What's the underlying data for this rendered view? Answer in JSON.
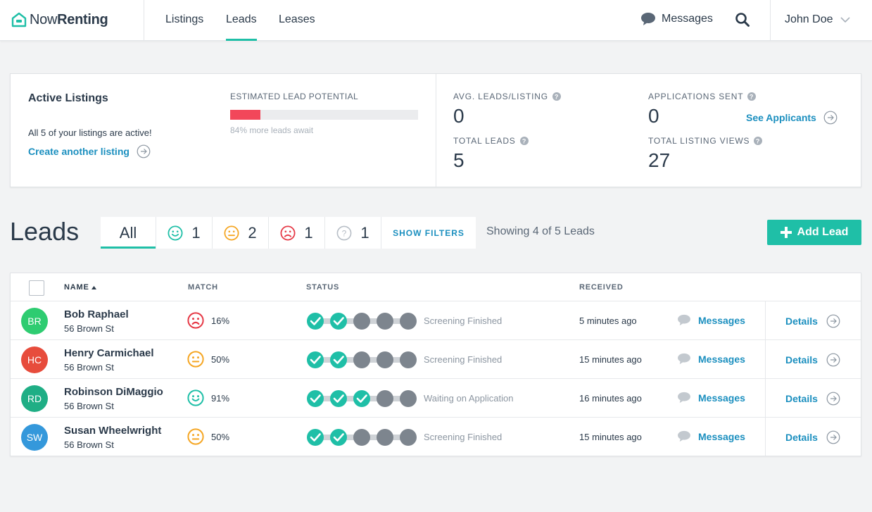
{
  "brand": {
    "name_regular": "Now",
    "name_bold": "Renting",
    "color": "#1fbfa7"
  },
  "nav": {
    "items": [
      {
        "label": "Listings"
      },
      {
        "label": "Leads"
      },
      {
        "label": "Leases"
      }
    ],
    "active": "Leads",
    "messages_label": "Messages",
    "user_name": "John Doe"
  },
  "summary": {
    "active_title": "Active Listings",
    "active_desc": "All 5 of your listings are active!",
    "create_link": "Create another listing",
    "lead_potential_label": "ESTIMATED LEAD POTENTIAL",
    "lead_potential_fraction": 0.16,
    "lead_potential_note": "84% more leads await",
    "stats": {
      "avg_leads_label": "AVG. LEADS/LISTING",
      "avg_leads_value": "0",
      "applications_label": "APPLICATIONS SENT",
      "applications_value": "0",
      "see_applicants": "See Applicants",
      "total_leads_label": "TOTAL LEADS",
      "total_leads_value": "5",
      "total_views_label": "TOTAL LISTING VIEWS",
      "total_views_value": "27"
    }
  },
  "leads": {
    "heading": "Leads",
    "tabs": {
      "all": "All",
      "happy": "1",
      "neutral": "2",
      "sad": "1",
      "unknown": "1",
      "filters": "SHOW FILTERS"
    },
    "showing": "Showing 4 of 5 Leads",
    "add_button": "Add Lead"
  },
  "table": {
    "headers": {
      "name": "NAME",
      "match": "MATCH",
      "status": "STATUS",
      "received": "RECEIVED"
    },
    "messages_label": "Messages",
    "details_label": "Details",
    "rows": [
      {
        "initials": "BR",
        "avatar_color": "#2ecc71",
        "name": "Bob Raphael",
        "address": "56 Brown St",
        "match_face": "sad",
        "match": "16%",
        "steps_done": 2,
        "status": "Screening Finished",
        "received": "5 minutes ago"
      },
      {
        "initials": "HC",
        "avatar_color": "#e74c3c",
        "name": "Henry Carmichael",
        "address": "56 Brown St",
        "match_face": "neutral",
        "match": "50%",
        "steps_done": 2,
        "status": "Screening Finished",
        "received": "15 minutes ago"
      },
      {
        "initials": "RD",
        "avatar_color": "#1fae85",
        "name": "Robinson DiMaggio",
        "address": "56 Brown St",
        "match_face": "happy",
        "match": "91%",
        "steps_done": 3,
        "status": "Waiting on Application",
        "received": "16 minutes ago"
      },
      {
        "initials": "SW",
        "avatar_color": "#3498db",
        "name": "Susan Wheelwright",
        "address": "56 Brown St",
        "match_face": "neutral",
        "match": "50%",
        "steps_done": 2,
        "status": "Screening Finished",
        "received": "15 minutes ago"
      }
    ]
  },
  "colors": {
    "accent": "#1fbfa7",
    "link": "#1b8fbf",
    "danger": "#f2475a",
    "happy": "#1fbfa7",
    "neutral": "#f5a623",
    "sad": "#e63946",
    "step_done": "#1fbfa7",
    "step_todo": "#7d858e"
  },
  "icons": {
    "messages": "speech-bubble-icon",
    "search": "magnifier-icon",
    "user_menu": "chevron-down-icon",
    "details": "circle-arrow-right-icon",
    "help": "question-circle-icon",
    "sort": "caret-up-icon",
    "add": "plus-icon"
  }
}
